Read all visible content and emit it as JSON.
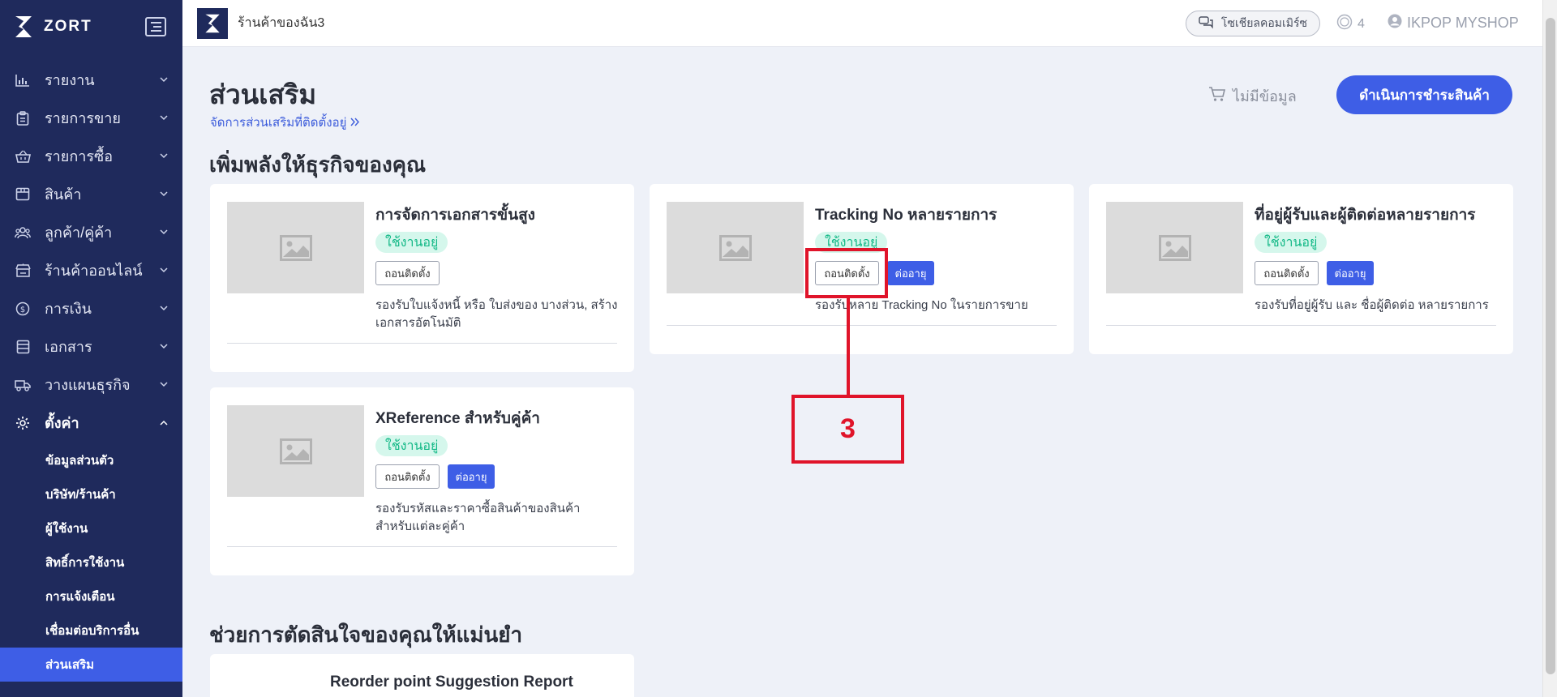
{
  "brand": {
    "name": "ZORT"
  },
  "sidebar": {
    "items": [
      {
        "label": "รายงาน",
        "icon": "bar-chart-icon"
      },
      {
        "label": "รายการขาย",
        "icon": "clipboard-icon"
      },
      {
        "label": "รายการซื้อ",
        "icon": "basket-icon"
      },
      {
        "label": "สินค้า",
        "icon": "box-icon"
      },
      {
        "label": "ลูกค้า/คู่ค้า",
        "icon": "users-icon"
      },
      {
        "label": "ร้านค้าออนไลน์",
        "icon": "store-icon"
      },
      {
        "label": "การเงิน",
        "icon": "coin-icon"
      },
      {
        "label": "เอกสาร",
        "icon": "document-icon"
      },
      {
        "label": "วางแผนธุรกิจ",
        "icon": "truck-icon"
      },
      {
        "label": "ตั้งค่า",
        "icon": "gear-icon"
      }
    ],
    "sub_items": [
      "ข้อมูลส่วนตัว",
      "บริษัท/ร้านค้า",
      "ผู้ใช้งาน",
      "สิทธิ์การใช้งาน",
      "การแจ้งเตือน",
      "เชื่อมต่อบริการอื่น",
      "ส่วนเสริม"
    ]
  },
  "topbar": {
    "shop_name": "ร้านค้าของฉัน3",
    "social_label": "โซเชียลคอมเมิร์ซ",
    "credits": "4",
    "user_name": "IKPOP MYSHOP"
  },
  "main": {
    "title": "ส่วนเสริม",
    "manage_link": "จัดการส่วนเสริมที่ติดตั้งอยู่",
    "cart_label": "ไม่มีข้อมูล",
    "checkout_label": "ดำเนินการชำระสินค้า",
    "section1_title": "เพิ่มพลังให้ธุรกิจของคุณ",
    "section2_title": "ช่วยการตัดสินใจของคุณให้แม่นยำ",
    "status_label": "ใช้งานอยู่",
    "uninstall_label": "ถอนติดตั้ง",
    "renew_label": "ต่ออายุ",
    "cards": [
      {
        "title": "การจัดการเอกสารขั้นสูง",
        "desc": "รองรับใบแจ้งหนี้ หรือ ใบส่งของ บางส่วน, สร้างเอกสารอัตโนมัติ"
      },
      {
        "title": "Tracking No หลายรายการ",
        "desc": "รองรับหลาย Tracking No ในรายการขาย"
      },
      {
        "title": "ที่อยู่ผู้รับและผู้ติดต่อหลายรายการ",
        "desc": "รองรับที่อยู่ผู้รับ และ ชื่อผู้ติดต่อ หลายรายการ"
      },
      {
        "title": "XReference สำหรับคู่ค้า",
        "desc": "รองรับรหัสและราคาซื้อสินค้าของสินค้า สำหรับแต่ละคู่ค้า"
      },
      {
        "title": "Reorder point Suggestion Report"
      }
    ]
  },
  "annotation": {
    "label": "3",
    "color": "#e0142a"
  }
}
